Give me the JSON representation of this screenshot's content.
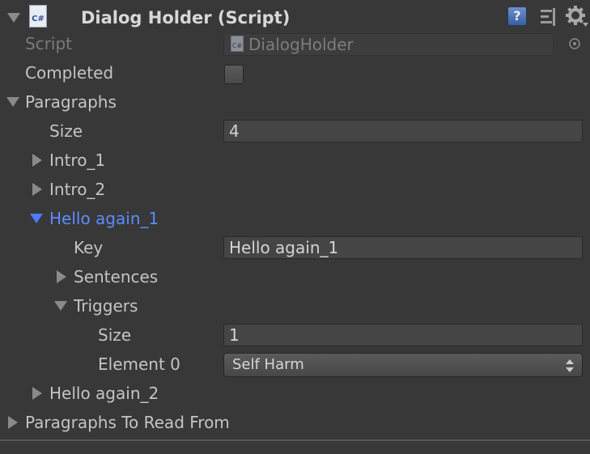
{
  "component": {
    "title": "Dialog Holder (Script)",
    "icon_text": "C#"
  },
  "script": {
    "label": "Script",
    "value": "DialogHolder",
    "icon_text": "C#"
  },
  "completed": {
    "label": "Completed",
    "checked": false
  },
  "paragraphs": {
    "label": "Paragraphs",
    "size_label": "Size",
    "size_value": "4",
    "items": [
      {
        "label": "Intro_1"
      },
      {
        "label": "Intro_2"
      },
      {
        "label": "Hello again_1"
      },
      {
        "label": "Hello again_2"
      }
    ],
    "expanded": {
      "key_label": "Key",
      "key_value": "Hello again_1",
      "sentences_label": "Sentences",
      "triggers_label": "Triggers",
      "triggers_size_label": "Size",
      "triggers_size_value": "1",
      "element0_label": "Element 0",
      "element0_value": "Self Harm"
    }
  },
  "paragraphs_to_read": {
    "label": "Paragraphs To Read From"
  },
  "colors": {
    "background": "#383838",
    "selected": "#5b8cff",
    "text": "#c4c4c4"
  }
}
